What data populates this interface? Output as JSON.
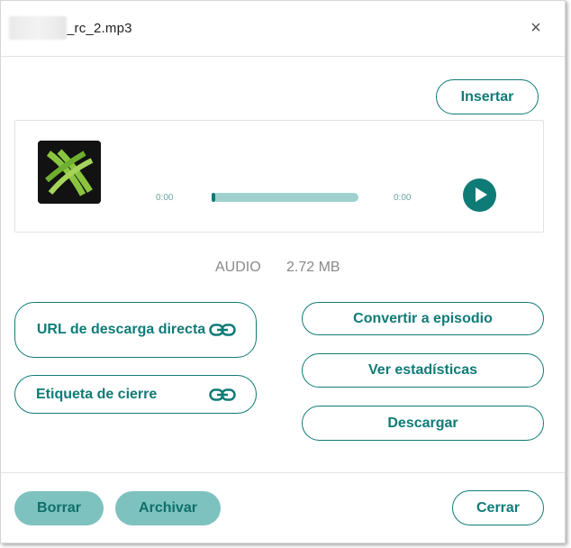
{
  "dialog": {
    "title": "_rc_2.mp3",
    "close_label": "×"
  },
  "toolbar": {
    "insert_label": "Insertar"
  },
  "player": {
    "logo_icon": "podcast-logo-icon",
    "current_time": "0:00",
    "total_time": "0:00",
    "progress": 0,
    "play_icon": "play-icon"
  },
  "file_info": {
    "type": "AUDIO",
    "size": "2.72 MB"
  },
  "actions": {
    "direct_download_url": "URL de descarga directa",
    "closing_tag": "Etiqueta de cierre",
    "convert_to_episode": "Convertir a episodio",
    "view_statistics": "Ver estadísticas",
    "download": "Descargar"
  },
  "footer": {
    "delete_label": "Borrar",
    "archive_label": "Archivar",
    "close_label": "Cerrar"
  },
  "colors": {
    "accent": "#0f7b77",
    "accent_light": "#7ec2bf",
    "track": "#9fd2cf"
  }
}
